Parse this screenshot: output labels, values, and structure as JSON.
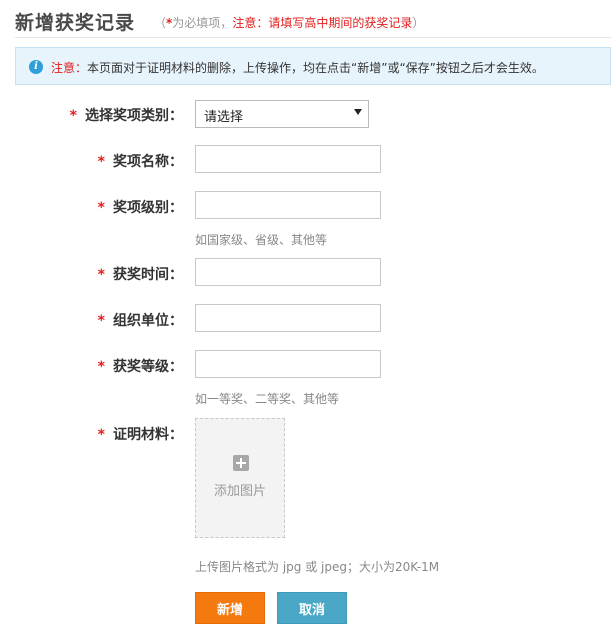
{
  "header": {
    "title": "新增获奖记录",
    "hint_open": "（",
    "required_star": "*",
    "required_text": "为必填项，",
    "notice": "注意：请填写高中期间的获奖记录",
    "hint_close": "）"
  },
  "info": {
    "icon": "info-icon",
    "lead": "注意：",
    "text": "本页面对于证明材料的删除，上传操作，均在点击“新增”或“保存”按钮之后才会生效。"
  },
  "form": {
    "required_mark": "*",
    "award_category": {
      "label": "选择奖项类别：",
      "selected": "请选择"
    },
    "award_name": {
      "label": "奖项名称：",
      "value": ""
    },
    "award_level": {
      "label": "奖项级别：",
      "value": "",
      "help": "如国家级、省级、其他等"
    },
    "award_time": {
      "label": "获奖时间：",
      "value": ""
    },
    "organizer": {
      "label": "组织单位：",
      "value": ""
    },
    "award_grade": {
      "label": "获奖等级：",
      "value": "",
      "help": "如一等奖、二等奖、其他等"
    },
    "proof": {
      "label": "证明材料：",
      "upload_text": "添加图片",
      "help": "上传图片格式为 jpg 或 jpeg；大小为20K-1M"
    }
  },
  "buttons": {
    "add": "新增",
    "cancel": "取消"
  }
}
